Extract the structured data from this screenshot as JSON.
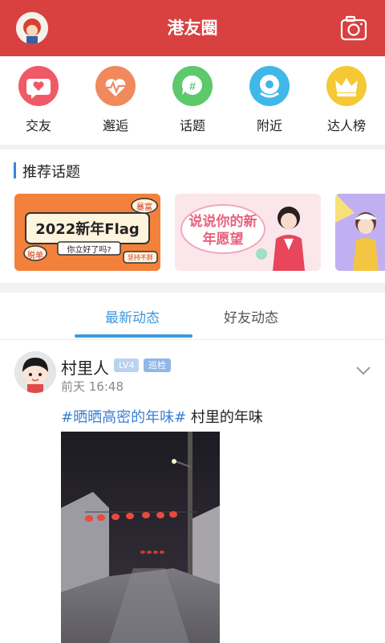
{
  "header": {
    "title": "港友圈"
  },
  "categories": [
    {
      "label": "交友",
      "icon": "heart-chat-icon",
      "color": "#ef5a66"
    },
    {
      "label": "邂逅",
      "icon": "heartbeat-icon",
      "color": "#f08a5d"
    },
    {
      "label": "话题",
      "icon": "hashtag-chat-icon",
      "color": "#5cc96b"
    },
    {
      "label": "附近",
      "icon": "location-pin-icon",
      "color": "#3fb8e8"
    },
    {
      "label": "达人榜",
      "icon": "crown-icon",
      "color": "#f5c935"
    }
  ],
  "topics": {
    "title": "推荐话题",
    "banners": [
      {
        "main": "2022新年Flag",
        "sub": "你立好了吗?",
        "tag1": "暴富",
        "tag2": "脱单",
        "tag3": "坚持不胖"
      },
      {
        "main": "说说你的新年愿望"
      },
      {
        "main": ""
      }
    ]
  },
  "tabs": [
    {
      "label": "最新动态",
      "active": true
    },
    {
      "label": "好友动态",
      "active": false
    }
  ],
  "post": {
    "author": "村里人",
    "level": "LV4",
    "role": "巡检",
    "time": "前天 16:48",
    "hashtag": "#晒晒高密的年味#",
    "text": " 村里的年味"
  }
}
